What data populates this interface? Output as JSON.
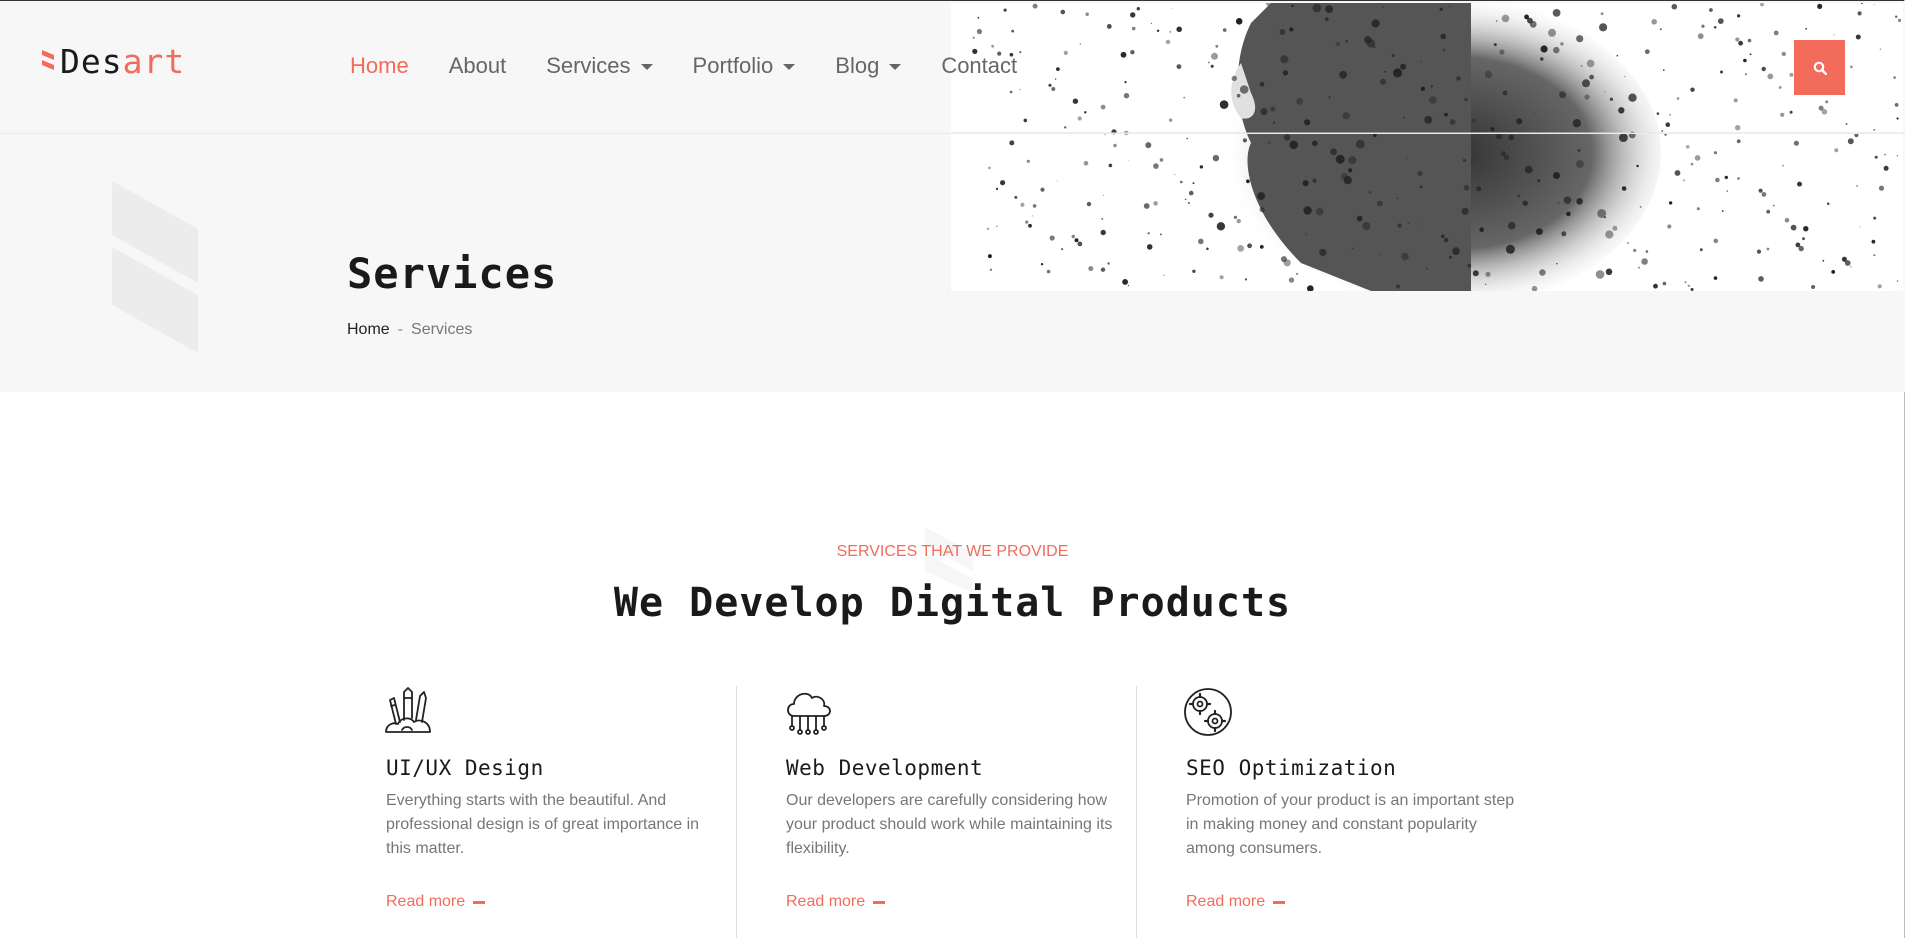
{
  "brand": {
    "name_part1": "Des",
    "name_part2": "art",
    "accent": "#f26b5b"
  },
  "nav": {
    "items": [
      {
        "label": "Home",
        "active": true,
        "dropdown": false
      },
      {
        "label": "About",
        "active": false,
        "dropdown": false
      },
      {
        "label": "Services",
        "active": false,
        "dropdown": true
      },
      {
        "label": "Portfolio",
        "active": false,
        "dropdown": true
      },
      {
        "label": "Blog",
        "active": false,
        "dropdown": true
      },
      {
        "label": "Contact",
        "active": false,
        "dropdown": false
      }
    ],
    "search_icon": "search-icon"
  },
  "page": {
    "title": "Services",
    "breadcrumb": {
      "home": "Home",
      "separator": "-",
      "current": "Services"
    }
  },
  "section": {
    "eyebrow": "SERVICES THAT WE PROVIDE",
    "title": "We Develop Digital Products"
  },
  "services": [
    {
      "icon": "design-tools-icon",
      "title": "UI/UX Design",
      "description": "Everything starts with the beautiful. And professional design is of great importance in this matter.",
      "link": "Read more"
    },
    {
      "icon": "cloud-network-icon",
      "title": "Web Development",
      "description": "Our developers are carefully considering how your product should work while maintaining its flexibility.",
      "link": "Read more"
    },
    {
      "icon": "gears-globe-icon",
      "title": "SEO Optimization",
      "description": "Promotion of your product is an important step in making money and constant popularity among consumers.",
      "link": "Read more"
    }
  ]
}
